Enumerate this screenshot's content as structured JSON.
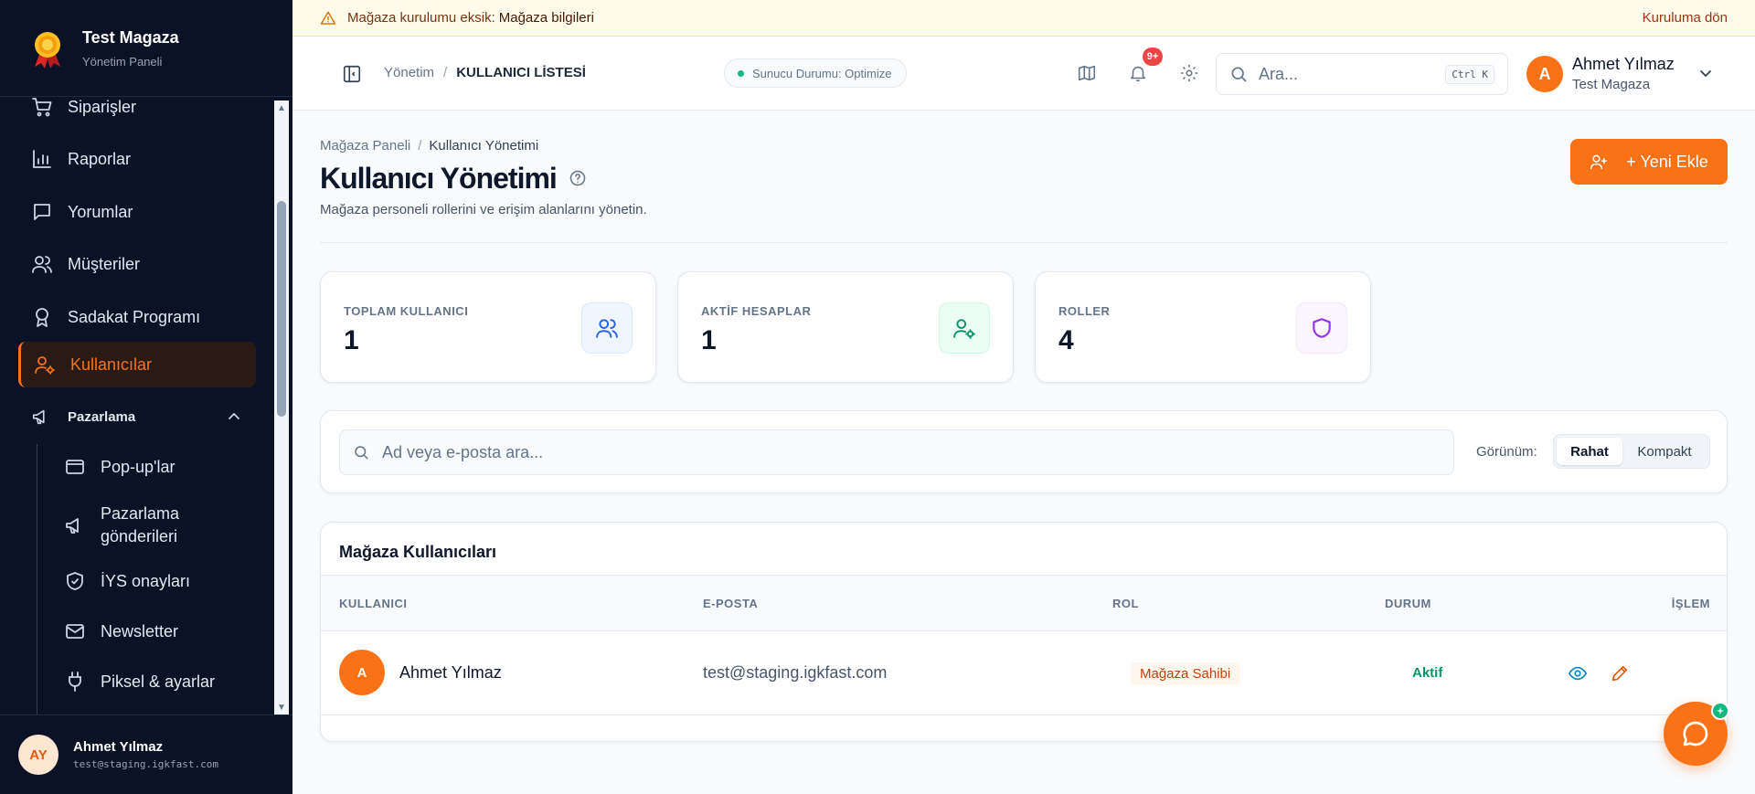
{
  "sidebar": {
    "brand_title": "Test Magaza",
    "brand_subtitle": "Yönetim Paneli",
    "items": [
      {
        "label": "Siparişler",
        "icon": "cart-icon"
      },
      {
        "label": "Raporlar",
        "icon": "bar-chart-icon"
      },
      {
        "label": "Yorumlar",
        "icon": "message-icon"
      },
      {
        "label": "Müşteriler",
        "icon": "users-icon"
      },
      {
        "label": "Sadakat Programı",
        "icon": "award-icon"
      },
      {
        "label": "Kullanıcılar",
        "icon": "user-cog-icon",
        "active": true
      }
    ],
    "group": {
      "label": "Pazarlama",
      "icon": "megaphone-icon"
    },
    "sub_items": [
      {
        "label": "Pop-up'lar",
        "icon": "window-icon"
      },
      {
        "label": "Pazarlama gönderileri",
        "icon": "megaphone-icon"
      },
      {
        "label": "İYS onayları",
        "icon": "shield-check-icon"
      },
      {
        "label": "Newsletter",
        "icon": "mail-icon"
      },
      {
        "label": "Piksel & ayarlar",
        "icon": "plug-icon"
      }
    ],
    "user": {
      "initials": "AY",
      "name": "Ahmet Yılmaz",
      "email": "test@staging.igkfast.com"
    }
  },
  "banner": {
    "text": "Mağaza kurulumu eksik:",
    "bold": "Mağaza bilgileri",
    "link": "Kuruluma dön"
  },
  "header": {
    "breadcrumb_root": "Yönetim",
    "breadcrumb_current": "KULLANICI LİSTESİ",
    "server_status": "Sunucu Durumu: Optimize",
    "notification_badge": "9+",
    "search_placeholder": "Ara...",
    "search_shortcut": "Ctrl K",
    "user_initial": "A",
    "user_name": "Ahmet Yılmaz",
    "user_store": "Test Magaza"
  },
  "page": {
    "breadcrumb_root": "Mağaza Paneli",
    "breadcrumb_current": "Kullanıcı Yönetimi",
    "title": "Kullanıcı Yönetimi",
    "subtitle": "Mağaza personeli rollerini ve erişim alanlarını yönetin.",
    "add_button": "+ Yeni Ekle"
  },
  "stats": [
    {
      "label": "TOPLAM KULLANICI",
      "value": "1",
      "icon": "users-icon",
      "color": "#2563eb"
    },
    {
      "label": "AKTİF HESAPLAR",
      "value": "1",
      "icon": "user-check-icon",
      "color": "#059669"
    },
    {
      "label": "ROLLER",
      "value": "4",
      "icon": "shield-icon",
      "color": "#9333ea"
    }
  ],
  "filter": {
    "search_placeholder": "Ad veya e-posta ara...",
    "view_label": "Görünüm:",
    "view_options": [
      "Rahat",
      "Kompakt"
    ]
  },
  "table": {
    "title": "Mağaza Kullanıcıları",
    "columns": [
      "KULLANICI",
      "E-POSTA",
      "ROL",
      "DURUM",
      "İŞLEM"
    ],
    "rows": [
      {
        "initial": "A",
        "name": "Ahmet Yılmaz",
        "email": "test@staging.igkfast.com",
        "role": "Mağaza Sahibi",
        "status": "Aktif"
      }
    ]
  },
  "colors": {
    "accent": "#f97316",
    "sidebar_bg": "#0b1226",
    "success": "#059669"
  }
}
